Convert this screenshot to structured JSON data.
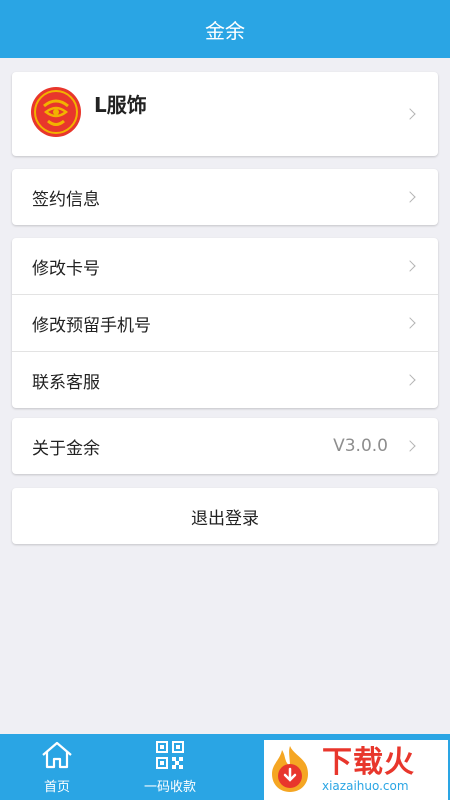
{
  "header": {
    "title": "金余"
  },
  "merchant": {
    "name": "L服饰"
  },
  "menu": {
    "contract": "签约信息",
    "change_card": "修改卡号",
    "change_phone": "修改预留手机号",
    "contact": "联系客服",
    "about": "关于金余",
    "version": "V3.0.0",
    "logout": "退出登录"
  },
  "tabbar": {
    "home": "首页",
    "qr": "一码收款"
  },
  "watermark": {
    "title": "下载火",
    "url": "xiazaihuo.com"
  },
  "colors": {
    "primary": "#2aa5e4",
    "background": "#efeff4",
    "logo_red": "#e8362c",
    "logo_gold": "#f2b200"
  }
}
